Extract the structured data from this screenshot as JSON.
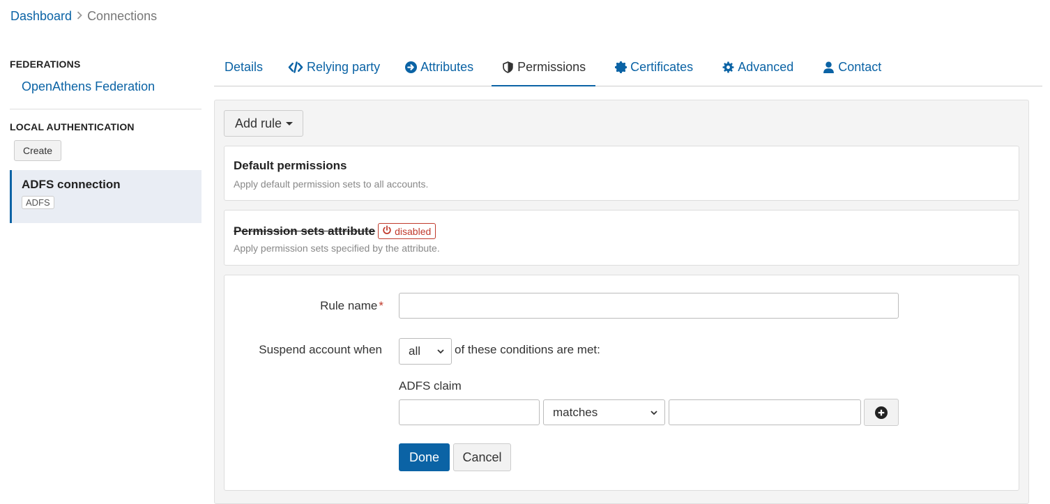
{
  "breadcrumb": {
    "dashboard": "Dashboard",
    "current": "Connections"
  },
  "sidebar": {
    "federations_heading": "FEDERATIONS",
    "federation_item": "OpenAthens Federation",
    "local_heading": "LOCAL AUTHENTICATION",
    "create_label": "Create",
    "active_item": {
      "name": "ADFS connection",
      "badge": "ADFS"
    }
  },
  "tabs": [
    {
      "label": "Details",
      "icon": ""
    },
    {
      "label": "Relying party",
      "icon": "code-icon"
    },
    {
      "label": "Attributes",
      "icon": "arrow-circle-right-icon"
    },
    {
      "label": "Permissions",
      "icon": "shield-icon",
      "active": true
    },
    {
      "label": "Certificates",
      "icon": "certificate-icon"
    },
    {
      "label": "Advanced",
      "icon": "gear-icon"
    },
    {
      "label": "Contact",
      "icon": "user-icon"
    }
  ],
  "panel": {
    "add_rule_label": "Add rule",
    "default_card": {
      "title": "Default permissions",
      "subtitle": "Apply default permission sets to all accounts."
    },
    "attribute_card": {
      "title": "Permission sets attribute",
      "badge": "disabled",
      "subtitle": "Apply permission sets specified by the attribute."
    },
    "rule_form": {
      "rule_name_label": "Rule name",
      "rule_name_required": "*",
      "rule_name_value": "",
      "suspend_label": "Suspend account when",
      "match_select_value": "all",
      "conditions_text": "of these conditions are met:",
      "claim_label": "ADFS claim",
      "claim_value": "",
      "operator_value": "matches",
      "match_value": "",
      "done_label": "Done",
      "cancel_label": "Cancel"
    }
  },
  "colors": {
    "link": "#0b63a5",
    "primary": "#0b63a5",
    "danger": "#c0392b",
    "panel_bg": "#f4f4f4",
    "active_bg": "#e9edf4"
  }
}
